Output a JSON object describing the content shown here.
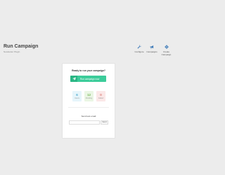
{
  "header": {
    "title": "Run Campaign",
    "subtitle": "Newsletter Plugin"
  },
  "toolbar": {
    "items": [
      {
        "label": "Configure",
        "icon": "wrench-icon"
      },
      {
        "label": "Campaigns",
        "icon": "megaphone-icon"
      },
      {
        "label": "Create Campaign",
        "icon": "gear-icon"
      }
    ]
  },
  "run_panel": {
    "heading": "Ready to run your campaign?",
    "button_label": "Run campaign now",
    "button_icon": "paper-plane-icon",
    "accent_color": "#3ccc9a"
  },
  "stats": [
    {
      "value": "6",
      "label": "Users",
      "color": "#4aa8cc"
    },
    {
      "value": "12",
      "label": "Pending",
      "color": "#77b85a"
    },
    {
      "value": "0",
      "label": "Failed",
      "color": "#d9776f"
    }
  ],
  "test_email": {
    "heading": "Send test email",
    "value": "",
    "placeholder": "",
    "send_label": "Send"
  }
}
